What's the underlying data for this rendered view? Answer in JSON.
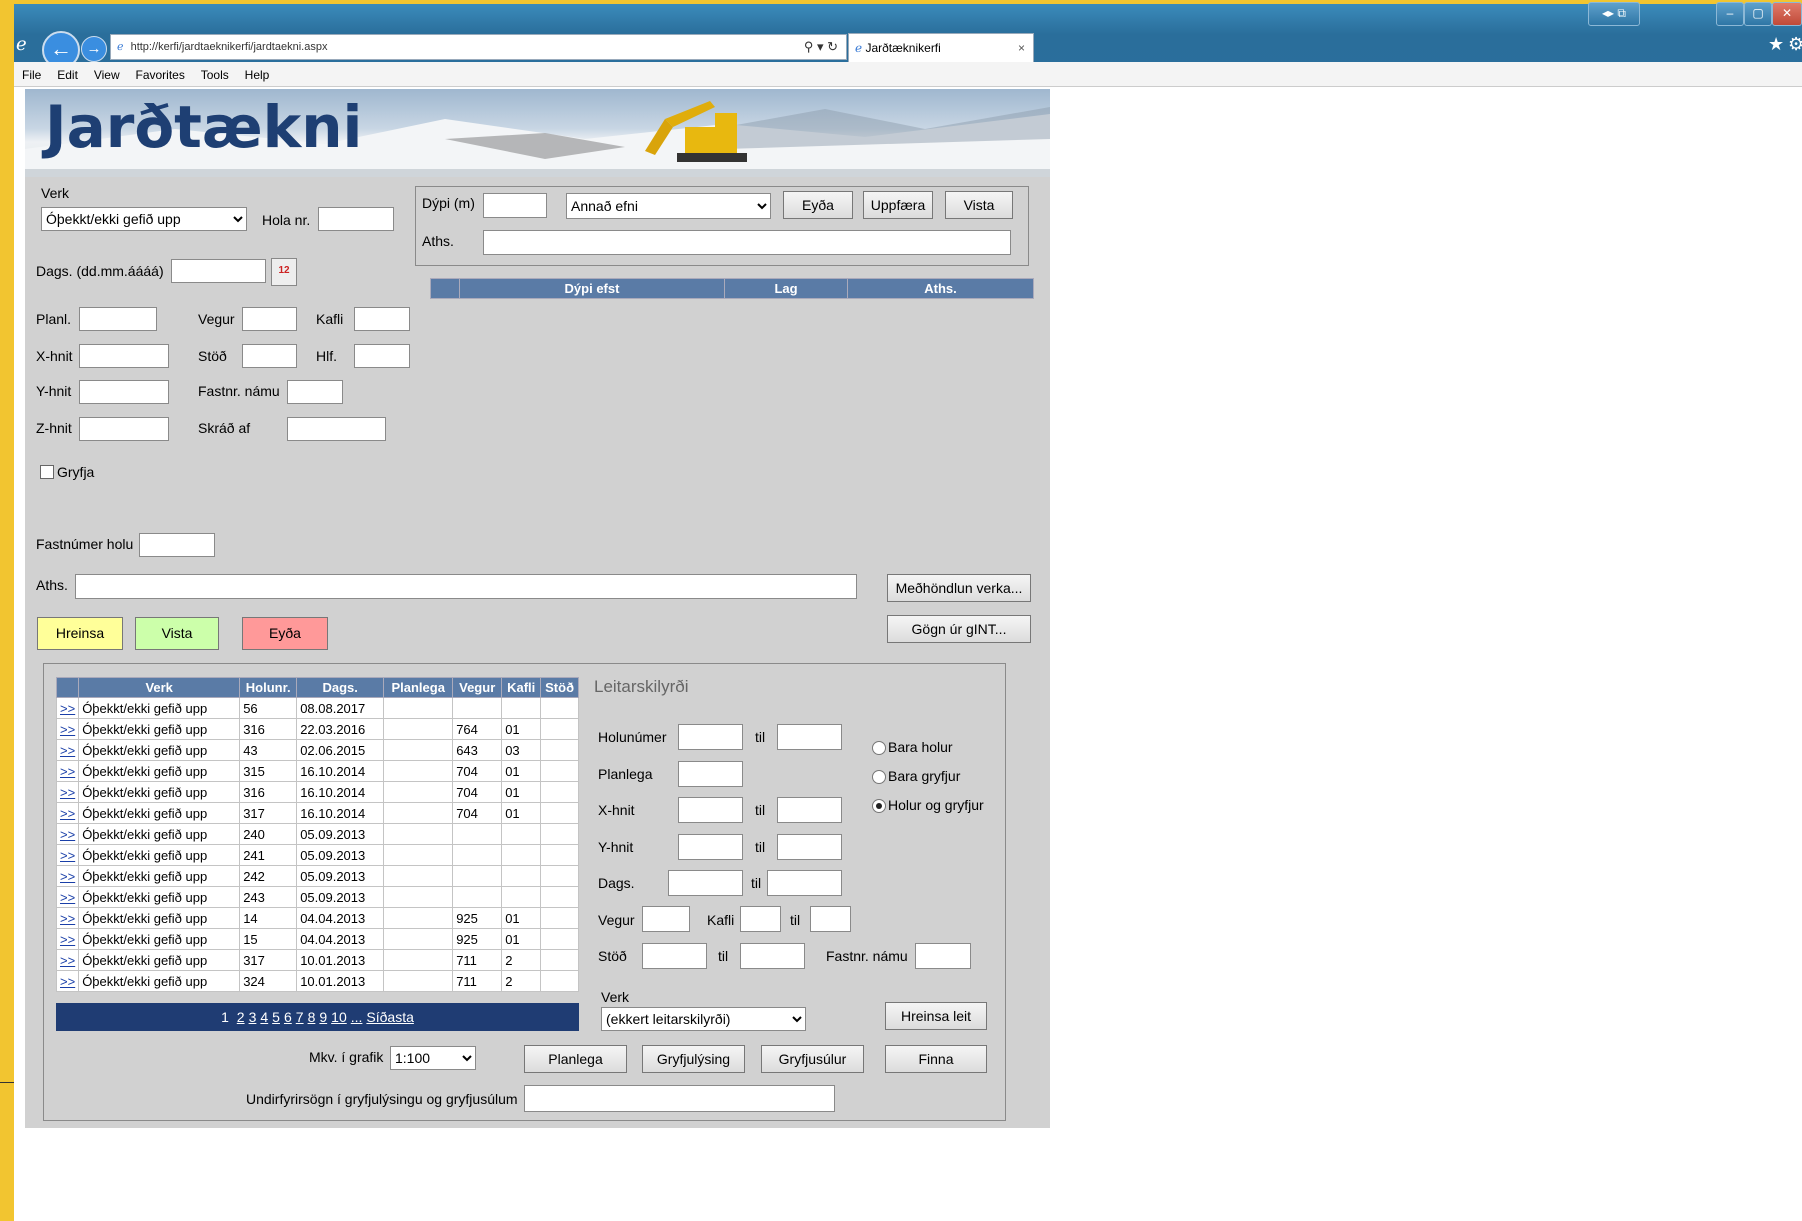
{
  "browser": {
    "url": "http://kerfi/jardtaeknikerfi/jardtaekni.aspx",
    "url_host_bold": "kerfi",
    "tab_title": "Jarðtæknikerfi",
    "menu": [
      "File",
      "Edit",
      "View",
      "Favorites",
      "Tools",
      "Help"
    ]
  },
  "banner": {
    "title": "Jarðtækni"
  },
  "form": {
    "verk_label": "Verk",
    "verk_value": "Óþekkt/ekki gefið upp",
    "hola_label": "Hola nr.",
    "dags_label": "Dags. (dd.mm.áááá)",
    "planl_label": "Planl.",
    "vegur_label": "Vegur",
    "kafli_label": "Kafli",
    "xhnit_label": "X-hnit",
    "stod_label": "Stöð",
    "hlf_label": "Hlf.",
    "yhnit_label": "Y-hnit",
    "fastnr_namu_label": "Fastnr. námu",
    "zhnit_label": "Z-hnit",
    "skrad_af_label": "Skráð af",
    "gryfja_label": "Gryfja",
    "fastnumer_holu_label": "Fastnúmer holu",
    "aths_label": "Aths."
  },
  "depth_panel": {
    "dypi_label": "Dýpi (m)",
    "efni_value": "Annað efni",
    "eyda": "Eyða",
    "uppfaera": "Uppfæra",
    "vista": "Vista",
    "aths_label": "Aths.",
    "columns": [
      "Dýpi efst",
      "Lag",
      "Aths."
    ]
  },
  "side_buttons": {
    "medhondlun": "Meðhöndlun verka...",
    "gogn": "Gögn úr gINT..."
  },
  "action_buttons": {
    "hreinsa": "Hreinsa",
    "vista": "Vista",
    "eyda": "Eyða"
  },
  "colors": {
    "hreinsa": "#ffff99",
    "vista": "#ccffaa",
    "eyda": "#ff9999",
    "grid_header": "#5a7ba6",
    "pager": "#1f3c73"
  },
  "results": {
    "columns": [
      "",
      "Verk",
      "Holunr.",
      "Dags.",
      "Planlega",
      "Vegur",
      "Kafli",
      "Stöð"
    ],
    "rows": [
      [
        ">>",
        "Óþekkt/ekki gefið upp",
        "56",
        "08.08.2017",
        "",
        "",
        "",
        ""
      ],
      [
        ">>",
        "Óþekkt/ekki gefið upp",
        "316",
        "22.03.2016",
        "",
        "764",
        "01",
        ""
      ],
      [
        ">>",
        "Óþekkt/ekki gefið upp",
        "43",
        "02.06.2015",
        "",
        "643",
        "03",
        ""
      ],
      [
        ">>",
        "Óþekkt/ekki gefið upp",
        "315",
        "16.10.2014",
        "",
        "704",
        "01",
        ""
      ],
      [
        ">>",
        "Óþekkt/ekki gefið upp",
        "316",
        "16.10.2014",
        "",
        "704",
        "01",
        ""
      ],
      [
        ">>",
        "Óþekkt/ekki gefið upp",
        "317",
        "16.10.2014",
        "",
        "704",
        "01",
        ""
      ],
      [
        ">>",
        "Óþekkt/ekki gefið upp",
        "240",
        "05.09.2013",
        "",
        "",
        "",
        ""
      ],
      [
        ">>",
        "Óþekkt/ekki gefið upp",
        "241",
        "05.09.2013",
        "",
        "",
        "",
        ""
      ],
      [
        ">>",
        "Óþekkt/ekki gefið upp",
        "242",
        "05.09.2013",
        "",
        "",
        "",
        ""
      ],
      [
        ">>",
        "Óþekkt/ekki gefið upp",
        "243",
        "05.09.2013",
        "",
        "",
        "",
        ""
      ],
      [
        ">>",
        "Óþekkt/ekki gefið upp",
        "14",
        "04.04.2013",
        "",
        "925",
        "01",
        ""
      ],
      [
        ">>",
        "Óþekkt/ekki gefið upp",
        "15",
        "04.04.2013",
        "",
        "925",
        "01",
        ""
      ],
      [
        ">>",
        "Óþekkt/ekki gefið upp",
        "317",
        "10.01.2013",
        "",
        "711",
        "2",
        ""
      ],
      [
        ">>",
        "Óþekkt/ekki gefið upp",
        "324",
        "10.01.2013",
        "",
        "711",
        "2",
        ""
      ]
    ],
    "pager_current": "1",
    "pages": [
      "2",
      "3",
      "4",
      "5",
      "6",
      "7",
      "8",
      "9",
      "10",
      "...",
      "Síðasta"
    ]
  },
  "search": {
    "title": "Leitarskilyrði",
    "holunumer_label": "Holunúmer",
    "til": "til",
    "planlega_label": "Planlega",
    "xhnit_label": "X-hnit",
    "yhnit_label": "Y-hnit",
    "dags_label": "Dags.",
    "vegur_label": "Vegur",
    "kafli_label": "Kafli",
    "stod_label": "Stöð",
    "fastnr_namu_label": "Fastnr. námu",
    "verk_label": "Verk",
    "verk_value": "(ekkert leitarskilyrði)",
    "radios": [
      "Bara holur",
      "Bara gryfjur",
      "Holur og gryfjur"
    ],
    "radio_selected": "Holur og gryfjur",
    "hreinsa_leit": "Hreinsa leit"
  },
  "bottom": {
    "mkv_label": "Mkv. í grafik",
    "mkv_value": "1:100",
    "planlega": "Planlega",
    "gryfjulysing": "Gryfjulýsing",
    "gryfjusulur": "Gryfjusúlur",
    "finna": "Finna",
    "undirfyrirsogn_label": "Undirfyrirsögn í gryfjulýsingu og gryfjusúlum"
  }
}
